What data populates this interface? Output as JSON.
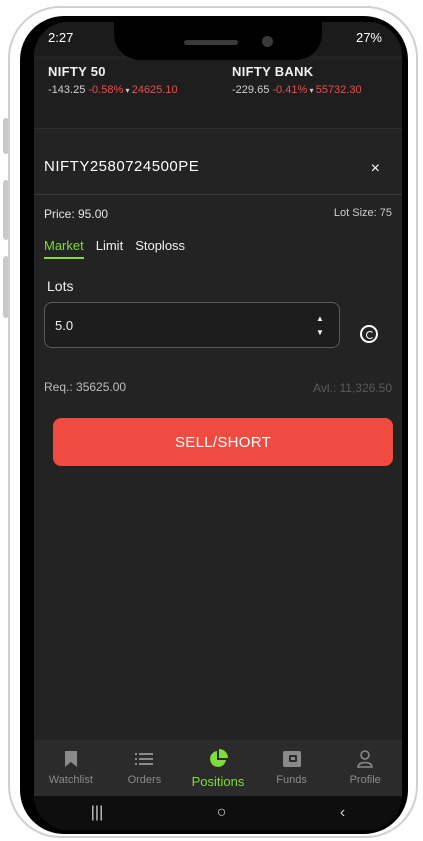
{
  "status": {
    "time": "2:27",
    "battery": "27%"
  },
  "ticker": [
    {
      "name": "NIFTY 50",
      "change": "-143.25",
      "pct": "-0.58%",
      "value": "24625.10"
    },
    {
      "name": "NIFTY BANK",
      "change": "-229.65",
      "pct": "-0.41%",
      "value": "55732.30"
    }
  ],
  "order": {
    "symbol": "NIFTY2580724500PE",
    "close": "×",
    "price": "Price: 95.00",
    "lot_size": "Lot Size: 75",
    "tabs": [
      "Market",
      "Limit",
      "Stoploss"
    ],
    "lots_label": "Lots",
    "lots_value": "5.0",
    "required": "Req.: 35625.00",
    "available": "Avl.: 11,326.50",
    "sell_label": "SELL/SHORT"
  },
  "nav": [
    {
      "label": "Watchlist",
      "icon": "bookmark-icon"
    },
    {
      "label": "Orders",
      "icon": "list-icon"
    },
    {
      "label": "Positions",
      "icon": "pie-chart-icon"
    },
    {
      "label": "Funds",
      "icon": "wallet-icon"
    },
    {
      "label": "Profile",
      "icon": "person-icon"
    }
  ],
  "active_nav": "Positions",
  "colors": {
    "accent": "#7fdc3a",
    "sell": "#ef4b40",
    "negative": "#f04b4b"
  }
}
